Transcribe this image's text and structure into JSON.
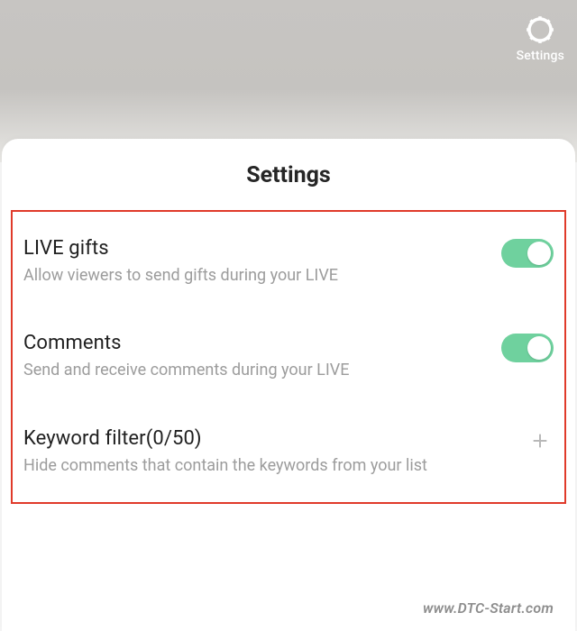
{
  "top_button": {
    "label": "Settings"
  },
  "sheet": {
    "title": "Settings",
    "rows": [
      {
        "title": "LIVE gifts",
        "subtitle": "Allow viewers to send gifts during your LIVE",
        "toggle_on": true
      },
      {
        "title": "Comments",
        "subtitle": "Send and receive comments during your LIVE",
        "toggle_on": true
      },
      {
        "title": "Keyword filter(0/50)",
        "subtitle": "Hide comments that contain the keywords from your list"
      }
    ]
  },
  "watermark": "www.DTC-Start.com"
}
